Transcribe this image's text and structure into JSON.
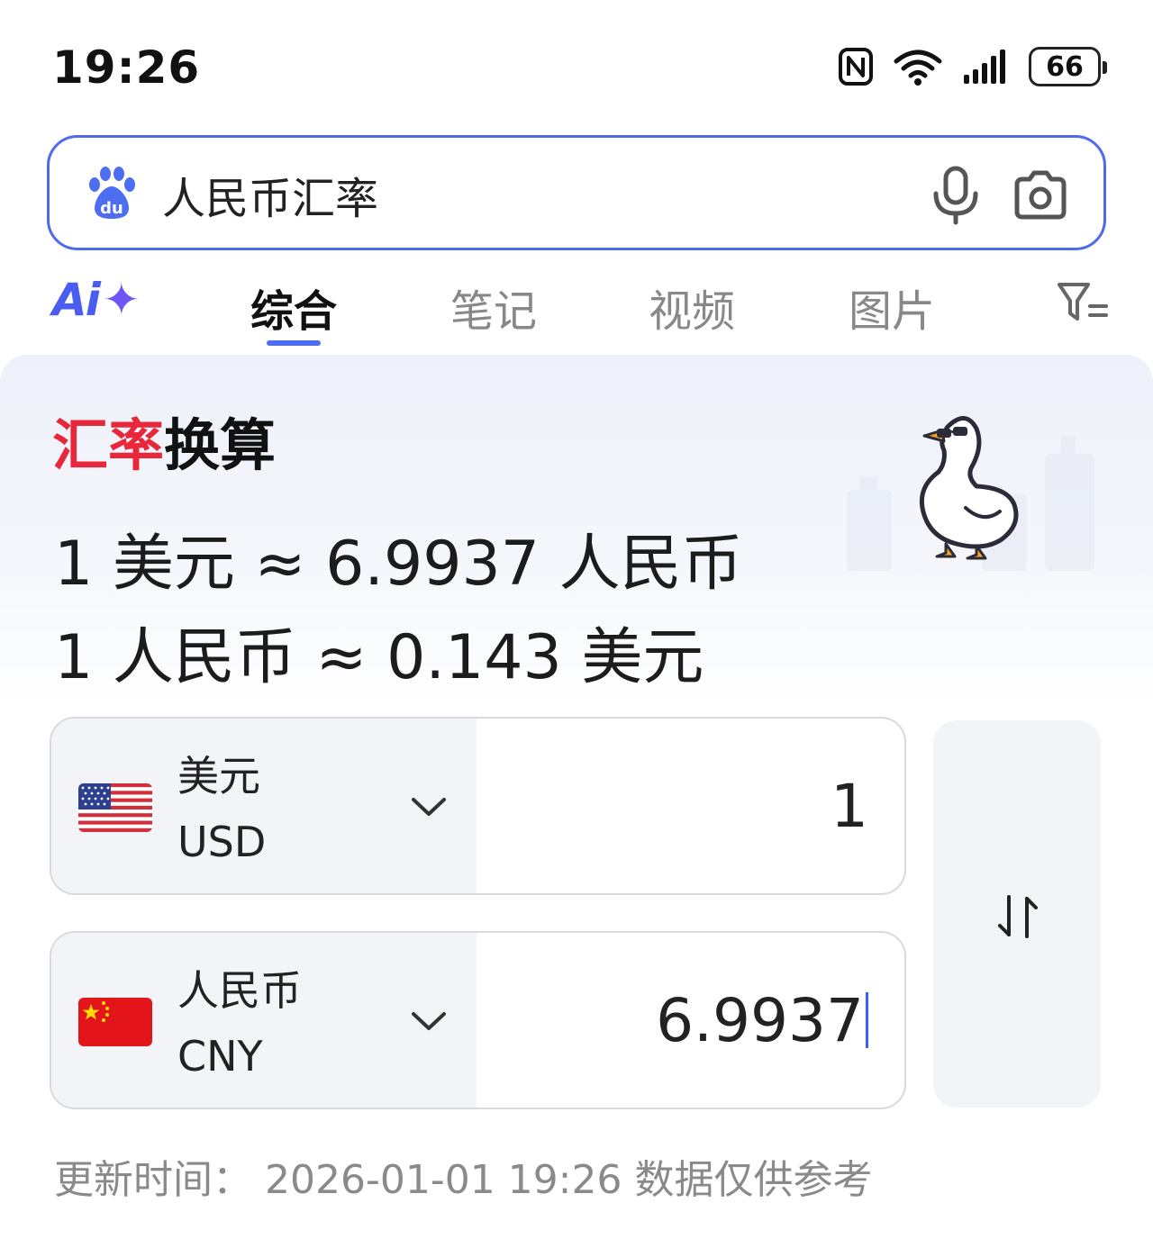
{
  "status_bar": {
    "time": "19:26",
    "battery": "66",
    "icons": [
      "nfc-icon",
      "wifi-icon",
      "signal-icon",
      "battery-icon"
    ]
  },
  "search": {
    "query": "人民币汇率",
    "logo": "baidu-paw-logo",
    "mic_icon": "microphone-icon",
    "camera_icon": "camera-icon"
  },
  "tabs": {
    "ai_label": "Ai",
    "ai_plus": "✦",
    "items": [
      "综合",
      "笔记",
      "视频",
      "图片"
    ],
    "active": "综合",
    "filter_icon": "filter-icon"
  },
  "card": {
    "title_red": "汇率",
    "title_dark": "换算",
    "rate_usd_to_cny": "1 美元 ≈ 6.9937 人民币",
    "rate_cny_to_usd": "1 人民币 ≈ 0.143 美元",
    "from": {
      "name": "美元",
      "code": "USD",
      "amount": "1",
      "flag": "us-flag"
    },
    "to": {
      "name": "人民币",
      "code": "CNY",
      "amount": "6.9937",
      "flag": "cn-flag"
    },
    "swap_icon": "swap-arrows-icon",
    "update_text": "更新时间：  2026-01-01 19:26 数据仅供参考"
  },
  "colors": {
    "accent": "#4e6ef2",
    "title_red": "#e8273b",
    "search_border": "#4f6bed"
  }
}
